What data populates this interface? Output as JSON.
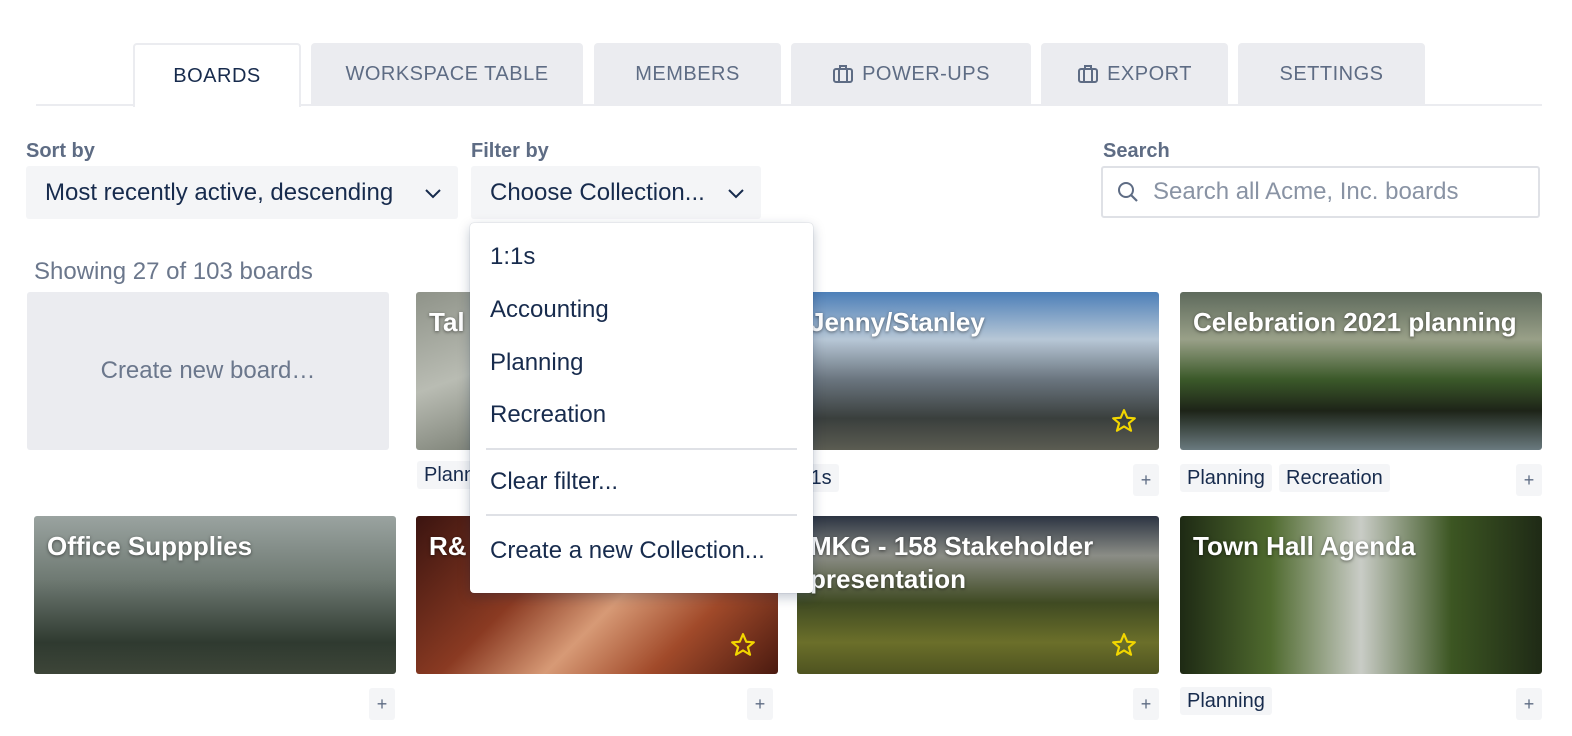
{
  "tabs": [
    {
      "label": "BOARDS",
      "active": true,
      "icon": null
    },
    {
      "label": "WORKSPACE TABLE",
      "active": false,
      "icon": null
    },
    {
      "label": "MEMBERS",
      "active": false,
      "icon": null
    },
    {
      "label": "POWER-UPS",
      "active": false,
      "icon": "briefcase-icon"
    },
    {
      "label": "EXPORT",
      "active": false,
      "icon": "briefcase-icon"
    },
    {
      "label": "SETTINGS",
      "active": false,
      "icon": null
    }
  ],
  "sort": {
    "label": "Sort by",
    "value": "Most recently active, descending"
  },
  "filter": {
    "label": "Filter by",
    "value": "Choose Collection...",
    "options": [
      "1:1s",
      "Accounting",
      "Planning",
      "Recreation"
    ],
    "clear_label": "Clear filter...",
    "create_label": "Create a new Collection..."
  },
  "search": {
    "label": "Search",
    "placeholder": "Search all Acme, Inc. boards"
  },
  "showing_text": "Showing 27 of 103 boards",
  "create_board_label": "Create new board…",
  "boards": [
    {
      "title": "Tal",
      "starred": false,
      "tags": [
        "Plann"
      ]
    },
    {
      "title": "Jenny/Stanley",
      "starred": true,
      "tags": [
        ":1s"
      ]
    },
    {
      "title": "Celebration 2021 planning",
      "starred": false,
      "tags": [
        "Planning",
        "Recreation"
      ]
    },
    {
      "title": "Office Suppplies",
      "starred": false,
      "tags": []
    },
    {
      "title": "R&",
      "starred": true,
      "tags": []
    },
    {
      "title": "MKG - 158 Stakeholder presentation",
      "starred": true,
      "tags": []
    },
    {
      "title": "Town Hall Agenda",
      "starred": false,
      "tags": [
        "Planning"
      ]
    }
  ],
  "add_label": "+",
  "colors": {
    "star": "#f2d600",
    "tab_bg": "#ebecf0",
    "text": "#172b4d",
    "muted": "#5e6c84"
  }
}
